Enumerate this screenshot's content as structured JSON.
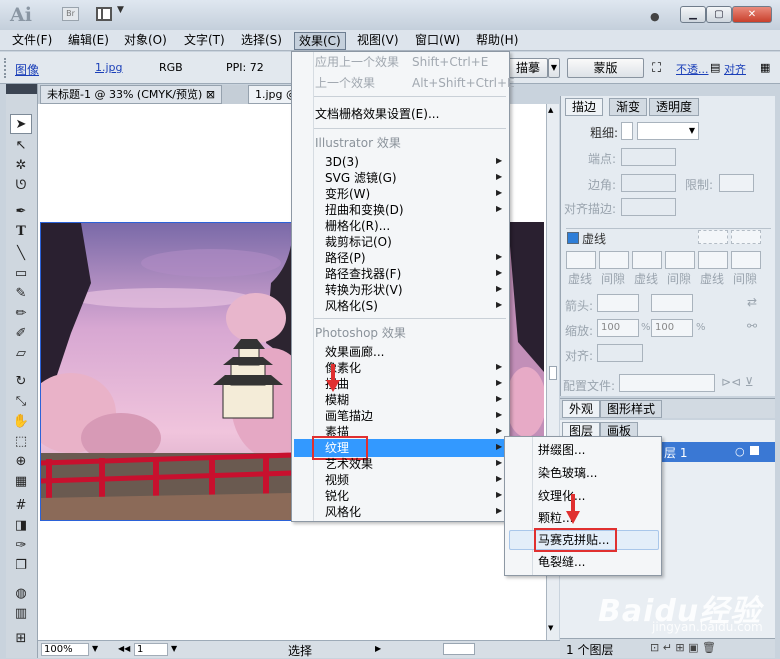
{
  "titlebar": {
    "logo": "Ai",
    "bridge": "Br",
    "search_label": "●",
    "buttons": [
      "▁",
      "▢",
      "✕"
    ]
  },
  "menubar": {
    "items": [
      "文件(F)",
      "编辑(E)",
      "对象(O)",
      "文字(T)",
      "选择(S)",
      "效果(C)",
      "视图(V)",
      "窗口(W)",
      "帮助(H)"
    ]
  },
  "control_bar": {
    "type_label": "图像",
    "file_link": "1.jpg",
    "color_mode": "RGB",
    "ppi": "PPI: 72",
    "trace_button": "描摹",
    "mask_button": "蒙版",
    "opacity_link": "不透...",
    "align_link": "对齐"
  },
  "document_tabs": [
    {
      "label": "未标题-1 @ 33% (CMYK/预览)",
      "close": "⊠"
    },
    {
      "label": "1.jpg @"
    }
  ],
  "effect_menu": {
    "items": [
      {
        "label": "应用上一个效果",
        "shortcut": "Shift+Ctrl+E",
        "disabled": true
      },
      {
        "label": "上一个效果",
        "shortcut": "Alt+Shift+Ctrl+E",
        "disabled": true
      },
      {
        "label": "文档栅格效果设置(E)..."
      },
      {
        "label": "Illustrator 效果",
        "section": true
      },
      {
        "label": "3D(3)",
        "submenu": true
      },
      {
        "label": "SVG 滤镜(G)",
        "submenu": true
      },
      {
        "label": "变形(W)",
        "submenu": true
      },
      {
        "label": "扭曲和变换(D)",
        "submenu": true
      },
      {
        "label": "栅格化(R)..."
      },
      {
        "label": "裁剪标记(O)"
      },
      {
        "label": "路径(P)",
        "submenu": true
      },
      {
        "label": "路径查找器(F)",
        "submenu": true
      },
      {
        "label": "转换为形状(V)",
        "submenu": true
      },
      {
        "label": "风格化(S)",
        "submenu": true
      },
      {
        "label": "Photoshop 效果",
        "section": true
      },
      {
        "label": "效果画廊..."
      },
      {
        "label": "像素化",
        "submenu": true
      },
      {
        "label": "扭曲",
        "submenu": true
      },
      {
        "label": "模糊",
        "submenu": true
      },
      {
        "label": "画笔描边",
        "submenu": true
      },
      {
        "label": "素描",
        "submenu": true
      },
      {
        "label": "纹理",
        "submenu": true,
        "highlighted": true
      },
      {
        "label": "艺术效果",
        "submenu": true
      },
      {
        "label": "视频",
        "submenu": true
      },
      {
        "label": "锐化",
        "submenu": true
      },
      {
        "label": "风格化",
        "submenu": true
      }
    ]
  },
  "texture_submenu": {
    "items": [
      "拼缀图...",
      "染色玻璃...",
      "纹理化...",
      "颗粒...",
      "马赛克拼贴...",
      "龟裂缝..."
    ]
  },
  "stroke_panel": {
    "tabs": [
      "描边",
      "渐变",
      "透明度"
    ],
    "weight_label": "粗细:",
    "cap_label": "端点:",
    "corner_label": "边角:",
    "limit_label": "限制:",
    "align_label": "对齐描边:",
    "dashed_label": "虚线",
    "dash_labels": [
      "虚线",
      "间隙",
      "虚线",
      "间隙",
      "虚线",
      "间隙"
    ],
    "arrow_label": "箭头:",
    "scale_label": "缩放:",
    "scale_value_1": "100",
    "scale_value_2": "100",
    "percent": "%",
    "align2_label": "对齐:",
    "profile_label": "配置文件:"
  },
  "appearance_panel": {
    "tabs": [
      "外观",
      "图形样式"
    ]
  },
  "layers_panel": {
    "tabs": [
      "图层",
      "画板"
    ],
    "layer_name": "层 1",
    "count": "1 个图层"
  },
  "status_bar": {
    "zoom": "100%",
    "page": "1",
    "mode": "选择"
  },
  "watermark": {
    "brand": "Baidu经验",
    "url": "jingyan.baidu.com"
  }
}
